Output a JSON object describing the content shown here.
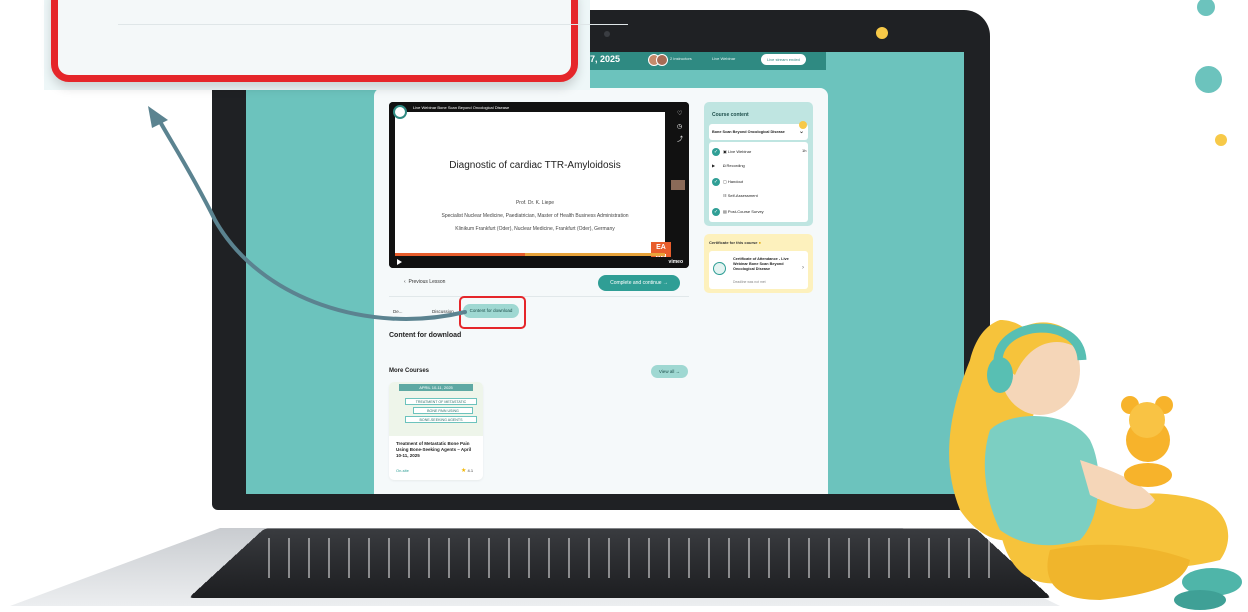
{
  "topbar": {
    "date": "7, 2025",
    "instructors": "2 instructors",
    "separator": "•",
    "live_label": "Live Webinar",
    "stream_status": "Live stream ended"
  },
  "video": {
    "header": "Live Webinar Bone Scan Beyond Oncological Disease",
    "slide_title": "Diagnostic of cardiac TTR-Amyloidosis",
    "presenter": "Prof. Dr. K. Liepe",
    "presenter_role": "Specialist Nuclear Medicine, Paediatrician, Master of Health Business Administration",
    "presenter_affiliation": "Klinikum Frankfurt (Oder), Nuclear Medicine, Frankfurt (Oder), Germany",
    "logo_text": "EA NM",
    "time": "00:26",
    "player_brand": "vimeo",
    "progress": 0.48
  },
  "nav": {
    "previous_lesson": "Previous Lesson",
    "complete_continue": "Complete and continue"
  },
  "tabs": [
    {
      "label": "De..."
    },
    {
      "label": "Discussion"
    },
    {
      "label": "Content for download"
    }
  ],
  "content_heading": "Content for download",
  "more_courses": {
    "heading": "More Courses",
    "view_all": "View all",
    "card": {
      "date": "APRIL 10-11, 2025",
      "band1": "TREATMENT OF METASTATIC",
      "band2": "BONE PAIN USING",
      "band3": "BONE-SEEKING AGENTS",
      "title": "Treatment of Metastatic Bone Pain Using Bone-Seeking Agents – April 10-11, 2025",
      "format": "On-site",
      "rating": "4.1"
    }
  },
  "sidebar": {
    "heading": "Course content",
    "selected_course": "Bone Scan Beyond Oncological Disease",
    "items": [
      {
        "label": "Live Webinar",
        "done": true,
        "extra": "1h"
      },
      {
        "label": "Recording",
        "done": false
      },
      {
        "label": "Handout",
        "done": true
      },
      {
        "label": "Self-Assessment",
        "done": false
      },
      {
        "label": "Post-Course Survey",
        "done": true
      }
    ]
  },
  "certificate": {
    "heading": "Certificate for this course",
    "title": "Certificate of Attendance - Live Webinar Bone Scan Beyond Oncological Disease",
    "deadline": "Deadline was not met"
  },
  "colors": {
    "teal": "#2f9e95",
    "teal_light": "#9fd8d2",
    "screen_bg": "#6cc3bd",
    "highlight": "#e5262a",
    "yellow": "#f7c948"
  }
}
